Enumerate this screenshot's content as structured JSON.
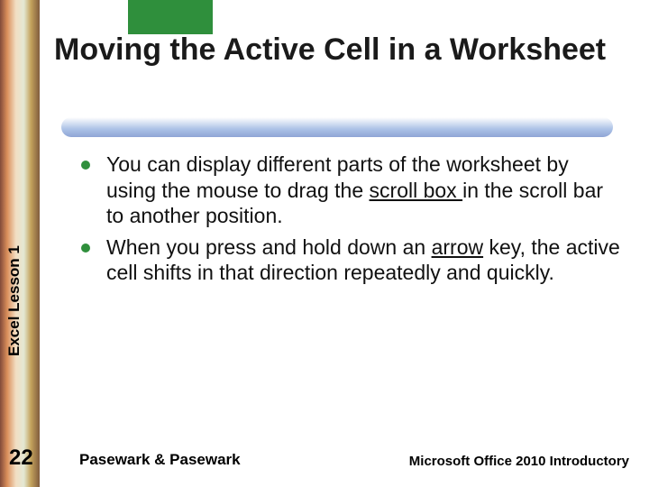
{
  "title": "Moving the Active Cell in a Worksheet",
  "bullets": [
    {
      "pre": "You can display different parts of the worksheet by using the mouse to drag the ",
      "u": "scroll box ",
      "post": "in the scroll bar to another position."
    },
    {
      "pre": " When you press and hold down an ",
      "u": "arrow",
      "post": " key, the active cell shifts in that direction repeatedly and quickly."
    }
  ],
  "sidebar_label": "Excel Lesson 1",
  "page_number": "22",
  "footer_left": "Pasewark & Pasewark",
  "footer_right": "Microsoft Office 2010 Introductory"
}
